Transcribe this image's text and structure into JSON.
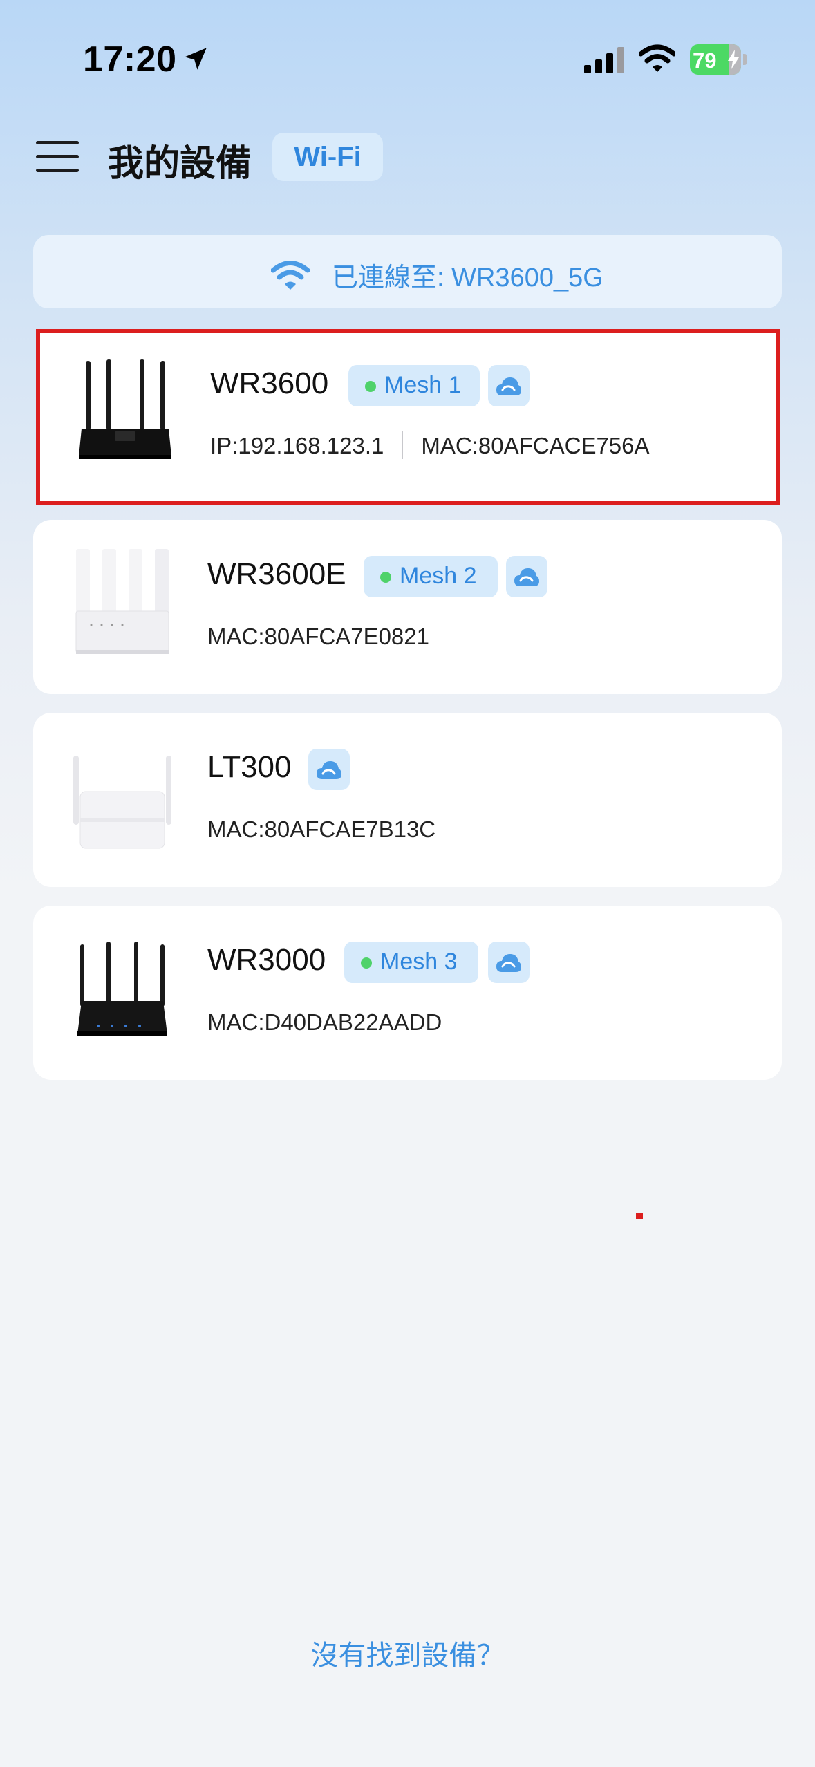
{
  "status_bar": {
    "time": "17:20",
    "battery": "79",
    "icons": [
      "location-arrow-icon",
      "cellular-signal-icon",
      "wifi-icon",
      "battery-charging-icon"
    ]
  },
  "header": {
    "title": "我的設備",
    "tab": "Wi-Fi",
    "menu_icon": "hamburger-menu-icon"
  },
  "connection": {
    "text": "已連線至: WR3600_5G",
    "icon": "wifi-icon"
  },
  "devices": [
    {
      "name": "WR3600",
      "mesh": "Mesh 1",
      "ip": "IP:192.168.123.1",
      "mac": "MAC:80AFCACE756A",
      "color": "black",
      "cloud": true,
      "selected": true
    },
    {
      "name": "WR3600E",
      "mesh": "Mesh 2",
      "mac": "MAC:80AFCA7E0821",
      "color": "white",
      "cloud": true
    },
    {
      "name": "LT300",
      "mesh": "",
      "mac": "MAC:80AFCAE7B13C",
      "color": "white",
      "cloud": true
    },
    {
      "name": "WR3000",
      "mesh": "Mesh 3",
      "mac": "MAC:D40DAB22AADD",
      "color": "black",
      "cloud": true
    }
  ],
  "footer": {
    "not_found": "沒有找到設備？"
  },
  "colors": {
    "accent": "#2f86dd",
    "mesh_online": "#4fd26a",
    "badge_bg": "#d6eafb",
    "selection": "#dc1e1e"
  }
}
